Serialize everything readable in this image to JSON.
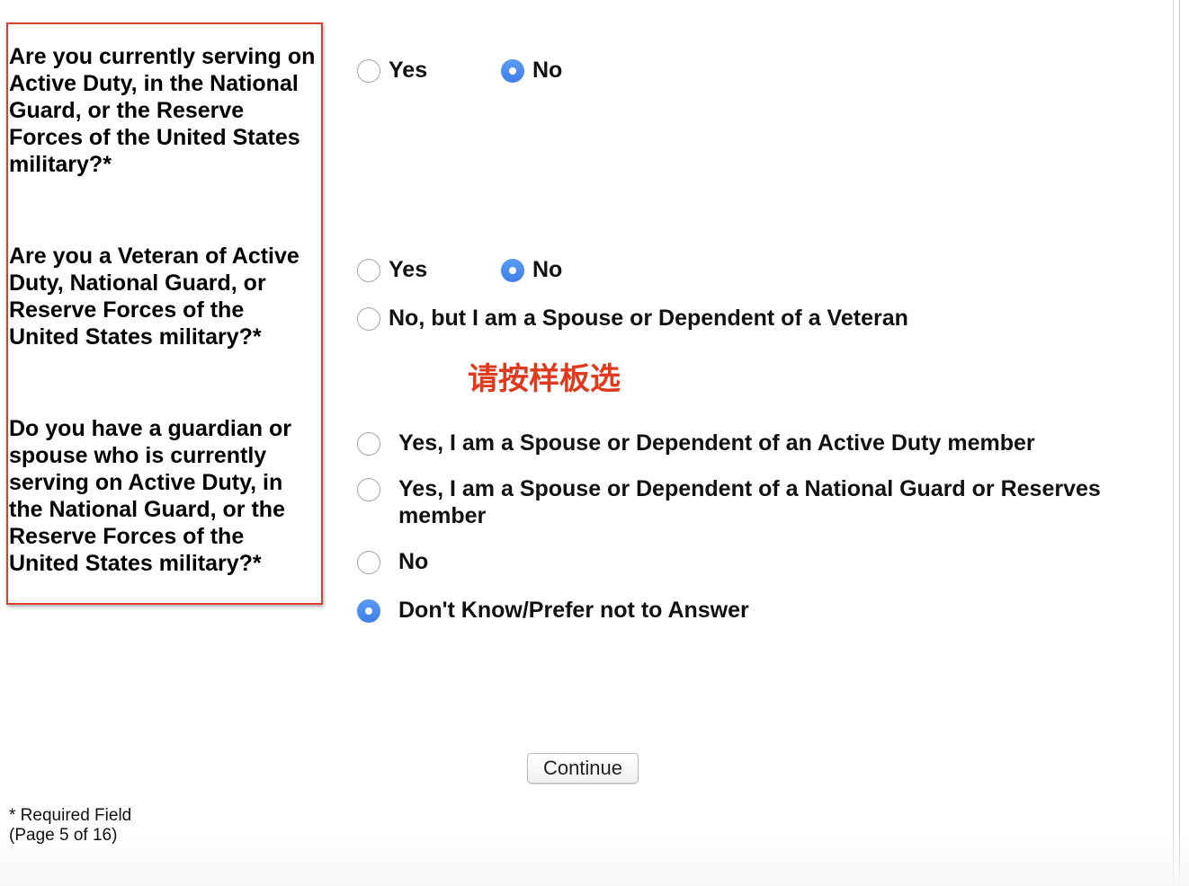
{
  "questions": [
    {
      "text": "Are you currently serving on Active Duty, in the National Guard, or the Reserve Forces of the United States military?*",
      "options": [
        {
          "label": "Yes",
          "checked": false
        },
        {
          "label": "No",
          "checked": true
        }
      ]
    },
    {
      "text": "Are you a Veteran of Active Duty, National Guard, or Reserve Forces of the United States military?*",
      "options": [
        {
          "label": "Yes",
          "checked": false
        },
        {
          "label": "No",
          "checked": true
        },
        {
          "label": "No, but I am a Spouse or Dependent of a Veteran",
          "checked": false
        }
      ]
    },
    {
      "text": "Do you have a guardian or spouse who is currently serving on Active Duty, in the National Guard, or the Reserve Forces of the United States military?*",
      "options": [
        {
          "label": "Yes, I am a Spouse or Dependent of an Active Duty member",
          "checked": false
        },
        {
          "label": "Yes, I am a Spouse or Dependent of a National Guard or Reserves member",
          "checked": false
        },
        {
          "label": "No",
          "checked": false
        },
        {
          "label": "Don't Know/Prefer not to Answer",
          "checked": true
        }
      ]
    }
  ],
  "annotation": "请按样板选",
  "continue_label": "Continue",
  "footer": {
    "required_note": "* Required Field",
    "page_indicator": "(Page 5 of 16)"
  },
  "colors": {
    "highlight_border": "#d8412f",
    "annotation_text": "#e03a1e",
    "radio_checked": "#4d8ef0"
  }
}
